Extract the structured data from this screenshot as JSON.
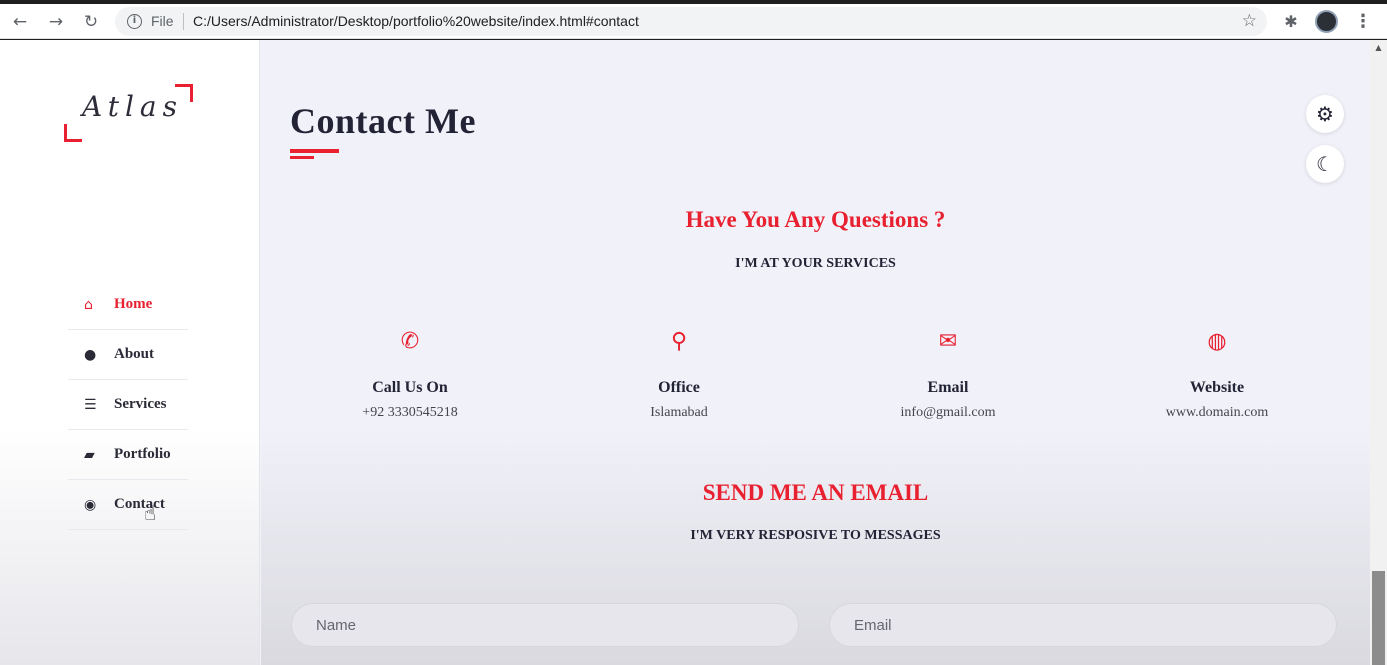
{
  "browser": {
    "back_icon": "←",
    "forward_icon": "→",
    "reload_icon": "↻",
    "file_label": "File",
    "url": "C:/Users/Administrator/Desktop/portfolio%20website/index.html#contact",
    "info_icon": "i",
    "star_icon": "☆",
    "extensions_icon": "✱",
    "menu_icon": "⋮"
  },
  "logo": {
    "text": "Atlas",
    "accent_color": "#e8202f"
  },
  "nav": {
    "items": [
      {
        "label": "Home",
        "icon": "⌂",
        "icon_name": "home-icon",
        "active": true
      },
      {
        "label": "About",
        "icon": "●",
        "icon_name": "user-icon",
        "active": false
      },
      {
        "label": "Services",
        "icon": "☰",
        "icon_name": "list-icon",
        "active": false
      },
      {
        "label": "Portfolio",
        "icon": "▰",
        "icon_name": "briefcase-icon",
        "active": false
      },
      {
        "label": "Contact",
        "icon": "◉",
        "icon_name": "comments-icon",
        "active": false
      }
    ],
    "cursor": "☝"
  },
  "main": {
    "title": "Contact Me",
    "settings_icon": "⚙",
    "theme_icon": "☾",
    "questions_heading": "Have You Any Questions ?",
    "questions_sub": "I'M AT YOUR SERVICES",
    "contacts": [
      {
        "icon": "✆",
        "icon_name": "phone-icon",
        "title": "Call Us On",
        "value": "+92 3330545218"
      },
      {
        "icon": "⚲",
        "icon_name": "location-icon",
        "title": "Office",
        "value": "Islamabad"
      },
      {
        "icon": "✉",
        "icon_name": "envelope-icon",
        "title": "Email",
        "value": "info@gmail.com"
      },
      {
        "icon": "◍",
        "icon_name": "globe-icon",
        "title": "Website",
        "value": "www.domain.com"
      }
    ],
    "email_heading": "SEND ME AN EMAIL",
    "email_sub": "I'M VERY RESPOSIVE TO MESSAGES",
    "form": {
      "name_placeholder": "Name",
      "email_placeholder": "Email"
    }
  },
  "colors": {
    "accent": "#e8202f",
    "heading": "#232336",
    "background": "#f1f1f9"
  }
}
